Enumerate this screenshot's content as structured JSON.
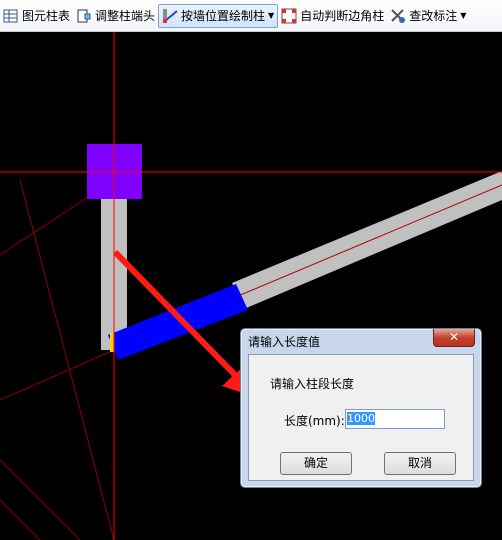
{
  "toolbar": {
    "items": [
      {
        "label": "图元柱表",
        "icon": "grid-table-icon"
      },
      {
        "label": "调整柱端头",
        "icon": "adjust-column-end-icon"
      },
      {
        "label": "按墙位置绘制柱",
        "icon": "draw-column-by-wall-icon"
      },
      {
        "label": "自动判断边角柱",
        "icon": "auto-corner-column-icon"
      },
      {
        "label": "查改标注",
        "icon": "edit-annotation-icon"
      }
    ]
  },
  "dialog": {
    "title": "请输入长度值",
    "close": "✕",
    "prompt": "请输入柱段长度",
    "field_label": "长度(mm):",
    "field_value": "1000",
    "ok_label": "确定",
    "cancel_label": "取消"
  },
  "colors": {
    "canvas": "#000000",
    "crosshair": "#ff0000",
    "column": "#7f00ff",
    "wall": "#c0c0c0",
    "selected_wall": "#0000ff",
    "arrow": "#ff1a1a"
  }
}
